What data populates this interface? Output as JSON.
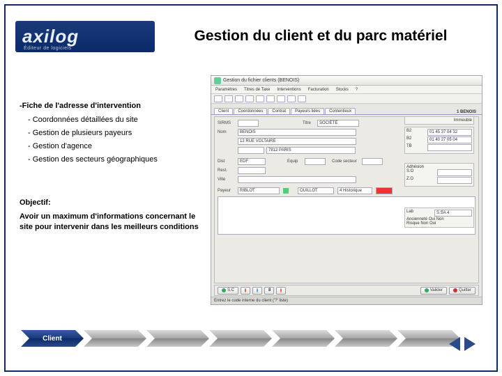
{
  "brand": {
    "name": "axilog",
    "tagline": "Éditeur de logiciels"
  },
  "title": "Gestion du client et du parc matériel",
  "section_heading": "-Fiche de l'adresse d'intervention",
  "bullets": [
    "- Coordonnées détaillées du site",
    "- Gestion de plusieurs payeurs",
    "- Gestion d'agence",
    "- Gestion des secteurs géographiques"
  ],
  "objective_label": "Objectif:",
  "objective_text": "Avoir un maximum d'informations concernant le site pour intervenir dans les meilleurs conditions",
  "screenshot": {
    "window_title": "Gestion du fichier clients (BENOIS)",
    "menus": [
      "Paramètres",
      "Titres de Taxe",
      "Interventions",
      "Facturation",
      "Stocks",
      "?"
    ],
    "tabs": [
      "Client",
      "Coordonnées",
      "Contrat",
      "Payeurs liées",
      "Contentieux"
    ],
    "header_right": "1 BENOIS",
    "form": {
      "sirms": "SIRMS",
      "nom_lbl": "Nom",
      "nom_val": "BENOIS",
      "titre_lbl": "Titre",
      "titre_val": "SOCIÉTÉ",
      "adr_lbl": "",
      "adr_val": "12 RUE VOLTAIRE",
      "dist_lbl": "Dist",
      "dist_val": "EDF",
      "ville_val": "7812  PARIS",
      "equip_lbl": "Equip",
      "codese_lbl": "Code secteur",
      "rest_lbl": "Rest.",
      "vile_lbl": "Ville",
      "payeur_lbl": "Payeur",
      "payeur_val": "RIBLOT",
      "sect_val": "OUILLOT",
      "histo_lbl": "4 Historique"
    },
    "sideboxes": {
      "immeuble": "Immeuble",
      "b2": "B2",
      "b2v": "01 45 37 04 32",
      "b2b": "B2",
      "b2bv": "01 40 27 05 04",
      "tb_lbl": "TB",
      "adh": "Adhésion",
      "so": "S.O",
      "zo": "Z.O",
      "lab": "Lab",
      "lab_val": "S.SA   4",
      "anciennete": "Ancienneté   Oui   Non",
      "risque": "Risque    Non   Oui"
    },
    "footer": {
      "sc": "S.C",
      "valider": "Valider",
      "quitter": "Quitter"
    },
    "status": "Entrez le code interne du client ('?' liste)"
  },
  "breadcrumb": {
    "active": "Client"
  },
  "nav": {
    "prev": "previous-slide",
    "next": "next-slide"
  }
}
